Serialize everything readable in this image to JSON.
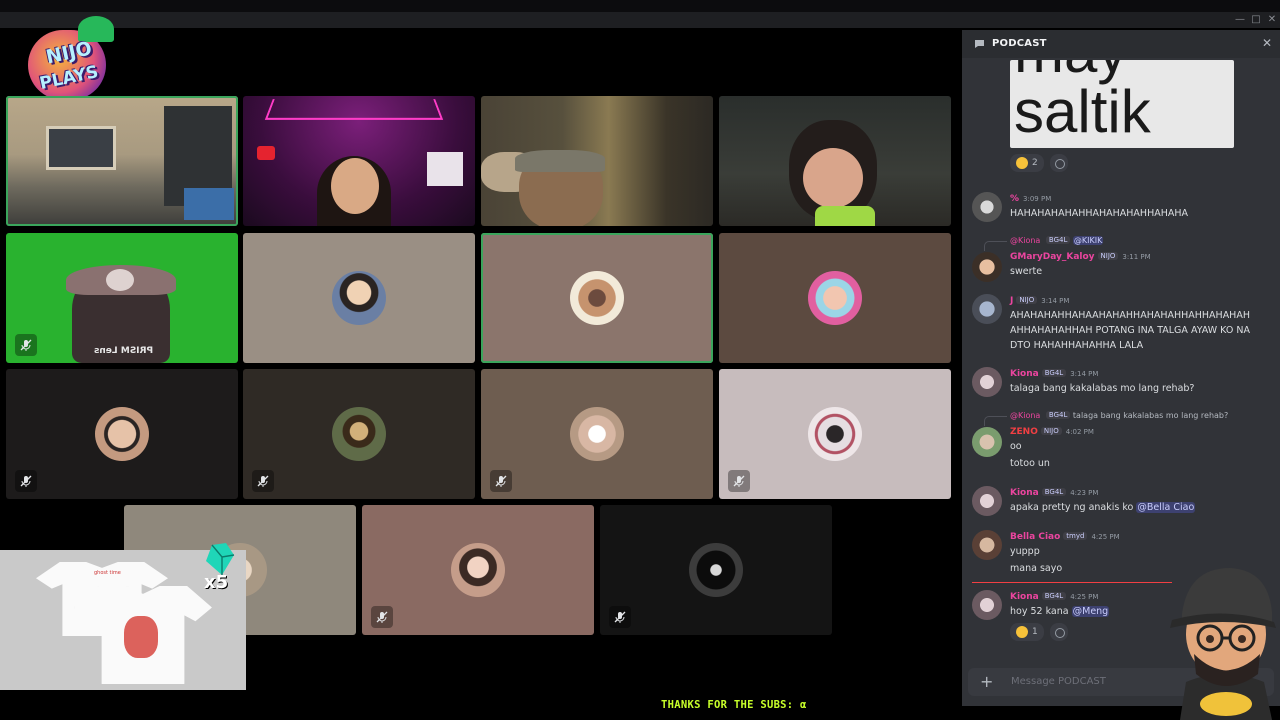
{
  "logo": {
    "line1": "NIJO",
    "line2": "PLAYS"
  },
  "video_grid": {
    "tiles": [
      {
        "kind": "camera",
        "selected": true
      },
      {
        "kind": "camera",
        "selected": false
      },
      {
        "kind": "camera",
        "selected": false
      },
      {
        "kind": "camera",
        "selected": false
      },
      {
        "kind": "camera",
        "selected": false,
        "muted": true,
        "name_tag": "PRISM Lens"
      },
      {
        "kind": "avatar",
        "selected": false
      },
      {
        "kind": "avatar",
        "selected": true
      },
      {
        "kind": "avatar",
        "selected": false
      },
      {
        "kind": "avatar",
        "muted": true
      },
      {
        "kind": "avatar",
        "muted": true
      },
      {
        "kind": "avatar",
        "muted": true
      },
      {
        "kind": "avatar",
        "muted": true
      },
      {
        "kind": "avatar",
        "muted": false
      },
      {
        "kind": "avatar",
        "muted": true
      },
      {
        "kind": "avatar",
        "muted": true
      }
    ]
  },
  "chat": {
    "channel": "PODCAST",
    "image_text": "saltik",
    "image_text_top": "may",
    "image_reactions": {
      "count": "2"
    },
    "messages": [
      {
        "name": "%",
        "time": "3:09 PM",
        "lines": [
          "HAHAHAHAHAHHAHAHAHAHHAHAHA"
        ]
      },
      {
        "reply_to": "@Kiona",
        "reply_tag": "BG4L",
        "reply_text": "@KIKIK",
        "name": "GMaryDay_Kaloy",
        "badge": "NIJO",
        "time": "3:11 PM",
        "lines": [
          "swerte"
        ]
      },
      {
        "name": "J",
        "badge": "NIJO",
        "time": "3:14 PM",
        "lines": [
          "AHAHAHAHHAHAAHAHAHHAHAHAHHAHHAHAHAH",
          "AHHAHAHAHHAH POTANG INA TALGA AYAW KO NA",
          "DTO HAHAHHAHAHHA LALA"
        ]
      },
      {
        "name": "Kiona",
        "badge": "BG4L",
        "time": "3:14 PM",
        "lines": [
          "talaga bang kakalabas mo lang rehab?"
        ]
      },
      {
        "reply_to": "@Kiona",
        "reply_tag": "BG4L",
        "reply_text": "talaga bang kakalabas mo lang rehab?",
        "name": "ZENO",
        "badge": "NIJO",
        "time": "4:02 PM",
        "lines": [
          "oo",
          "totoo un"
        ]
      },
      {
        "name": "Kiona",
        "badge": "BG4L",
        "time": "4:23 PM",
        "lines": [
          "apaka pretty ng anakis ko"
        ],
        "mention": "@Bella Ciao"
      },
      {
        "name": "Bella Ciao",
        "badge": "tmyd",
        "time": "4:25 PM",
        "lines": [
          "yuppp",
          "mana sayo"
        ]
      },
      {
        "name": "Kiona",
        "badge": "BG4L",
        "time": "4:25 PM",
        "lines": [
          "hoy 52 kana"
        ],
        "mention": "@Meng",
        "reaction_count": "1"
      }
    ],
    "composer_placeholder": "Message PODCAST"
  },
  "merch": {
    "multiplier": "x5",
    "shirt_brand": "ghost time"
  },
  "ticker": "THANKS FOR THE SUBS: α",
  "colors": {
    "accent_green": "#3ba55c",
    "kiona_pink": "#eb459f",
    "ticker": "#c8ff2a",
    "chat_bg": "#313338"
  }
}
